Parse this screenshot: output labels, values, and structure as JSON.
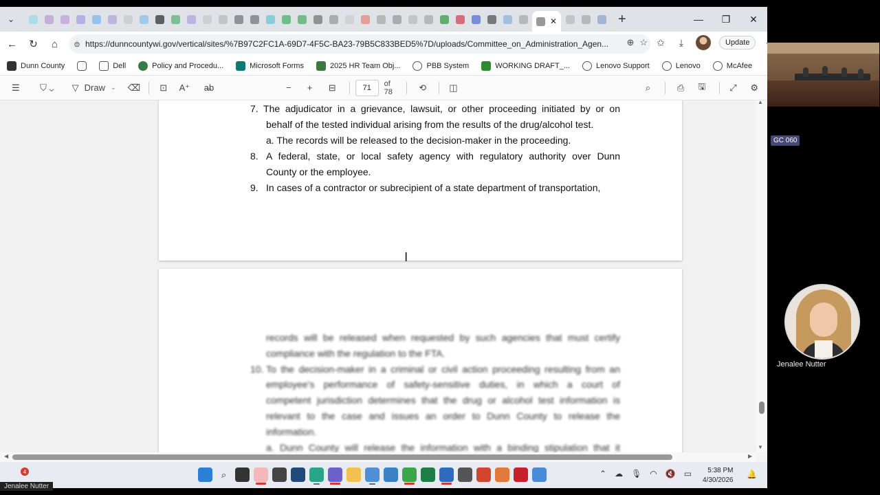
{
  "browser": {
    "url": "https://dunncountywi.gov/vertical/sites/%7B97C2FC1A-69D7-4F5C-BA23-79B5C833BED5%7D/uploads/Committee_on_Administration_Agen...",
    "update_label": "Update",
    "tab_close": "✕"
  },
  "bookmarks": [
    {
      "label": "Dunn County",
      "color": "#333333"
    },
    {
      "label": "",
      "color": "#555555"
    },
    {
      "label": "Dell",
      "color": "#777777"
    },
    {
      "label": "Policy and Procedu...",
      "color": "#3a7d44"
    },
    {
      "label": "Microsoft Forms",
      "color": "#0b7a75"
    },
    {
      "label": "2025 HR Team Obj...",
      "color": "#3d7a3f"
    },
    {
      "label": "PBB System",
      "color": "#5a5a5a"
    },
    {
      "label": "WORKING DRAFT_...",
      "color": "#2e8b2e"
    },
    {
      "label": "Lenovo Support",
      "color": "#5a5a5a"
    },
    {
      "label": "Lenovo",
      "color": "#5a5a5a"
    },
    {
      "label": "McAfee",
      "color": "#5a5a5a"
    }
  ],
  "pdf_toolbar": {
    "draw_label": "Draw",
    "current_page": "71",
    "page_total": "of 78"
  },
  "document": {
    "page1_lines": [
      "7.   The adjudicator in a grievance, lawsuit, or other proceeding initiated by or on",
      "behalf of the tested individual arising from the results of the drug/alcohol test.",
      "a.  The records will be released to the decision-maker in the proceeding.",
      "8.",
      "A federal, state, or local safety agency with regulatory authority over Dunn",
      "County or the employee.",
      "9.",
      "In cases of a contractor or subrecipient of a state department of transportation,"
    ],
    "page2_lines": [
      "records will be released when requested by such agencies that must certify",
      "compliance with the regulation to the FTA.",
      "10.",
      "To the decision-maker in a criminal or civil action proceeding resulting from an",
      "employee's performance of safety-sensitive duties, in which a court of",
      "competent jurisdiction determines that the drug or alcohol test information is",
      "relevant to the case and issues an order to Dunn County to release the",
      "information.",
      "a.  Dunn County will release the information with a binding stipulation that it"
    ]
  },
  "taskbar": {
    "badge_count": "4",
    "time": "5:38 PM",
    "date": "4/30/2026"
  },
  "meeting": {
    "room_label": "GC 060",
    "participant_name": "Jenalee Nutter",
    "presenter_name": "Jenalee Nutter"
  }
}
